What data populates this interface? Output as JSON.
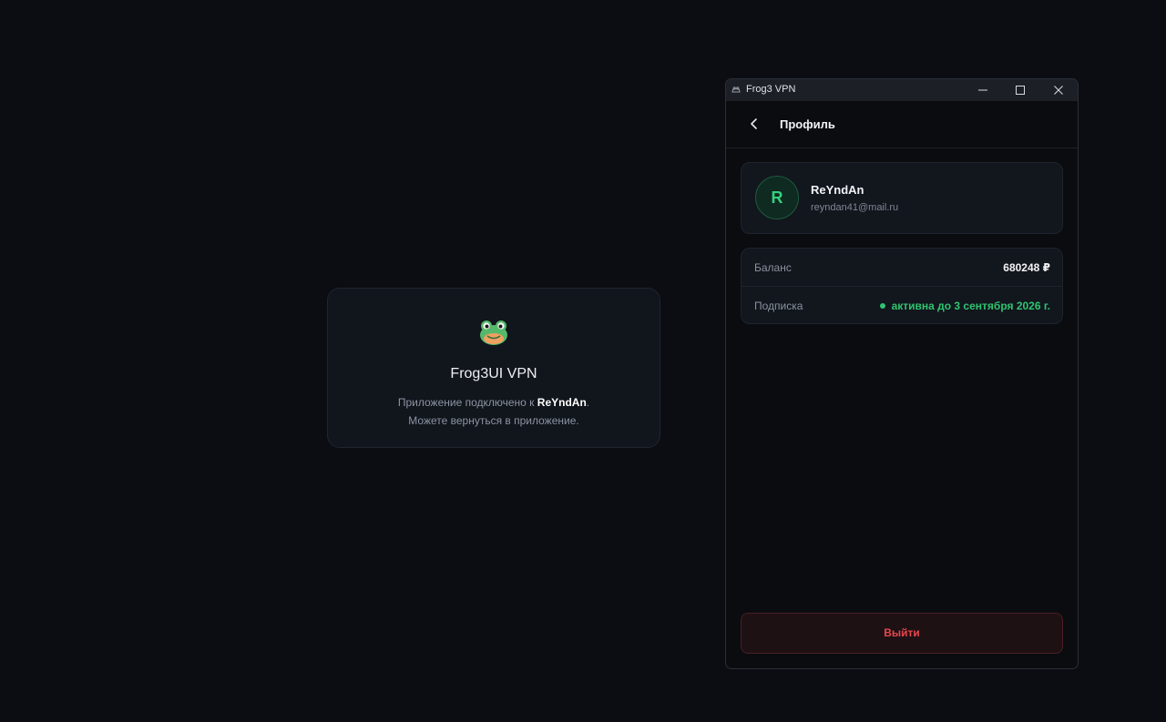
{
  "web_page": {
    "title": "Frog3UI VPN",
    "message_prefix": "Приложение подключено к ",
    "username": "ReYndAn",
    "message_suffix": ".",
    "message_line2": "Можете вернуться в приложение.",
    "logo_icon": "frog-icon"
  },
  "window": {
    "title": "Frog3 VPN",
    "icon": "app-icon",
    "controls": [
      "minimize-icon",
      "maximize-icon",
      "close-icon"
    ]
  },
  "header": {
    "title": "Профиль",
    "back_icon": "chevron-left-icon"
  },
  "profile": {
    "avatar_letter": "R",
    "name": "ReYndAn",
    "email": "reyndan41@mail.ru"
  },
  "info": {
    "balance_label": "Баланс",
    "balance_value": "680248 ₽",
    "subscription_label": "Подписка",
    "subscription_value": "активна до 3 сентября 2026 г."
  },
  "actions": {
    "logout_label": "Выйти"
  },
  "colors": {
    "accent_green": "#2fc46f",
    "danger_red": "#e5484d",
    "background": "#0b0d12"
  }
}
